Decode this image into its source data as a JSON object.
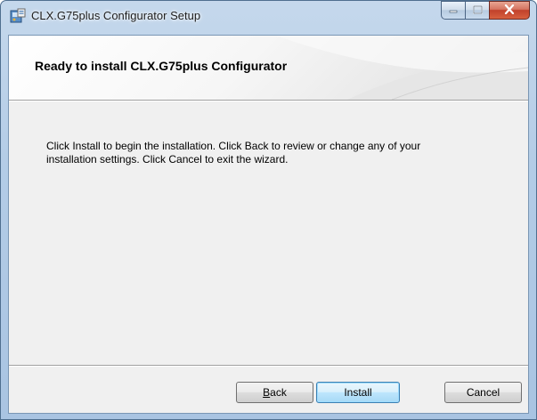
{
  "window": {
    "title": "CLX.G75plus Configurator Setup"
  },
  "banner": {
    "title": "Ready to install CLX.G75plus Configurator"
  },
  "body": {
    "line1": "Click Install to begin the installation. Click Back to review or change any of your",
    "line2": "installation settings. Click Cancel to exit the wizard."
  },
  "buttons": {
    "back_prefix": "",
    "back_underlined": "B",
    "back_rest": "ack",
    "install": "Install",
    "cancel": "Cancel"
  },
  "icons": {
    "app": "installer-setup-icon",
    "minimize": "minimize-icon",
    "maximize": "maximize-icon",
    "close": "close-icon"
  }
}
